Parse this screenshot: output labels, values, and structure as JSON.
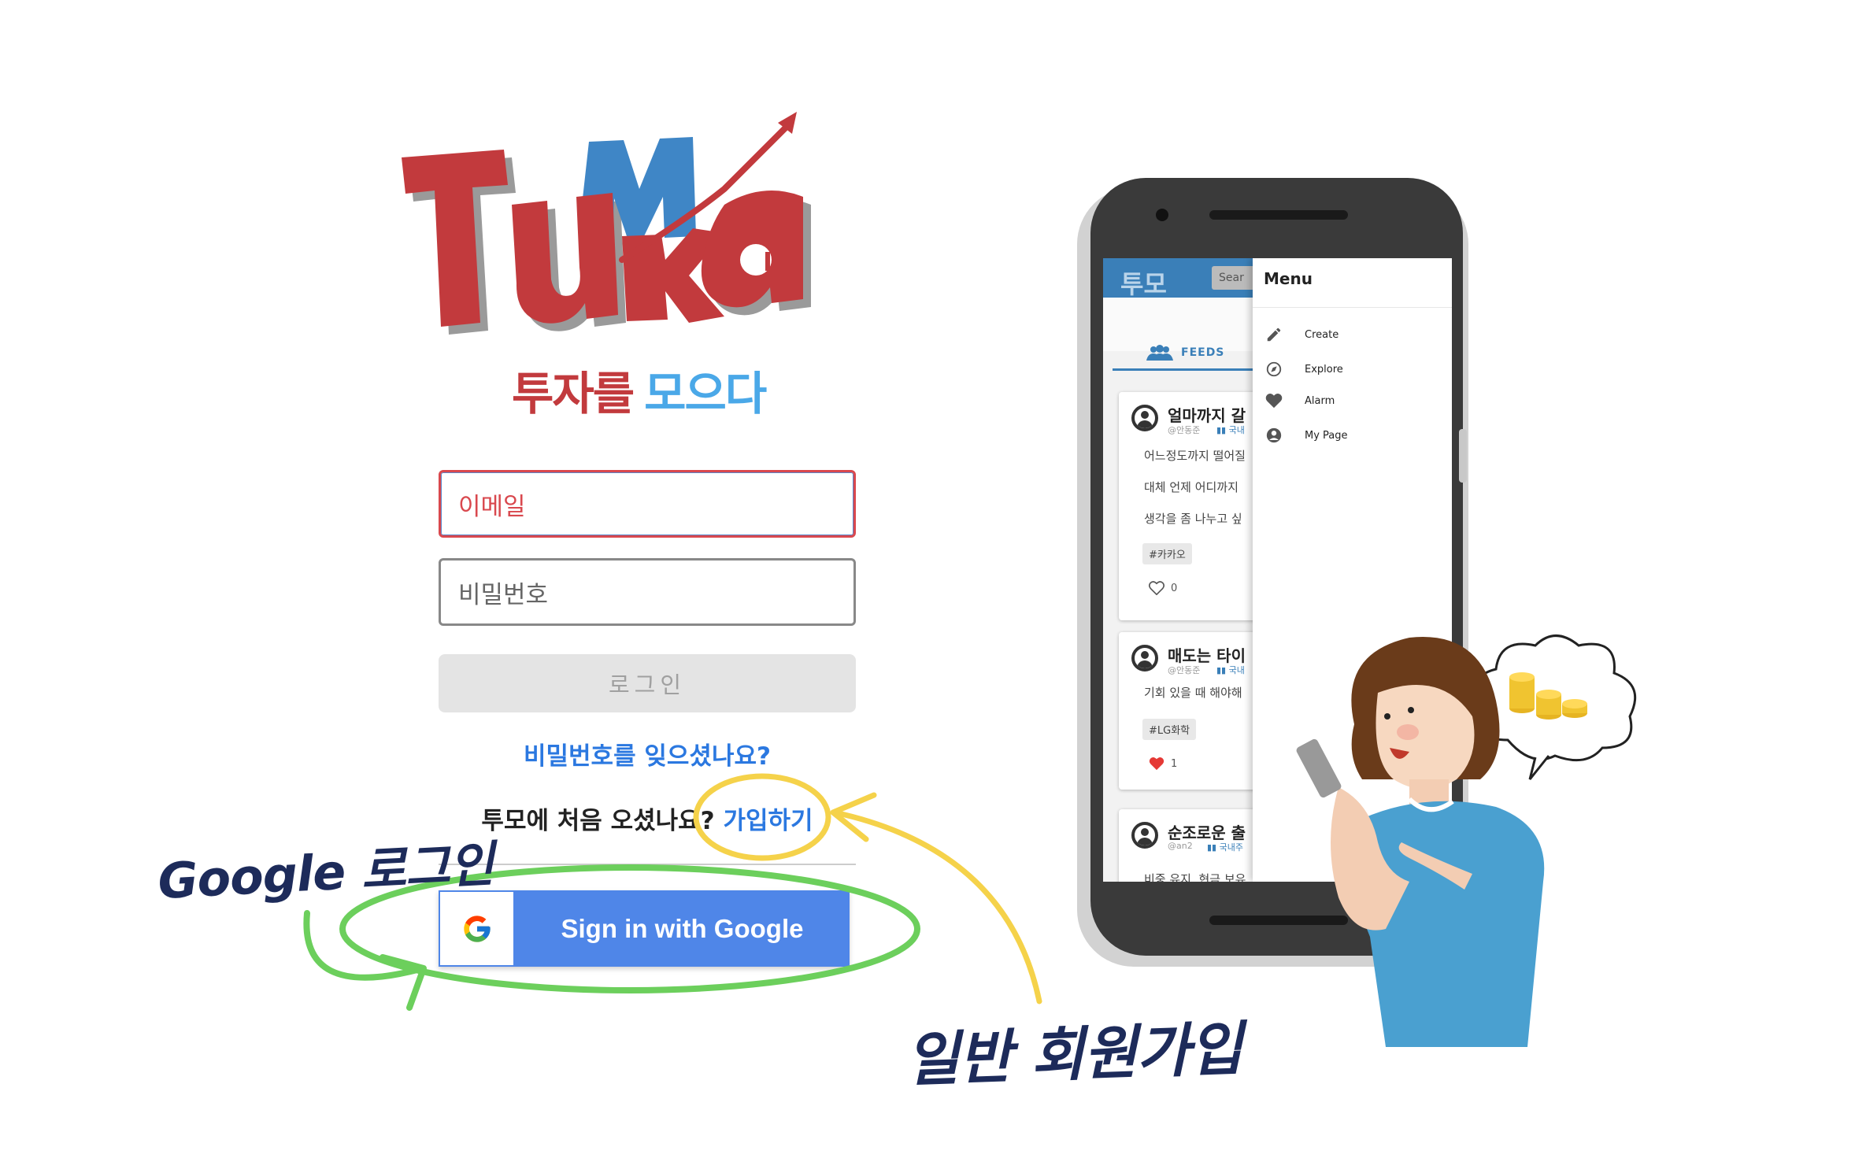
{
  "brand": {
    "logo_text": "TuMo",
    "tagline_part1": "투자를",
    "tagline_part2": "모으다"
  },
  "login": {
    "email_placeholder": "이메일",
    "password_placeholder": "비밀번호",
    "login_label": "로그인",
    "forgot_label": "비밀번호를 잊으셨나요?",
    "signup_prompt": "투모에 처음 오셨나요?",
    "signup_link": "가입하기",
    "google_label": "Sign in with Google"
  },
  "annotations": {
    "google_login": "Google 로그인",
    "signup": "일반 회원가입"
  },
  "phone": {
    "app_title": "투모",
    "search_placeholder": "Sear",
    "tab_feeds": "FEEDS",
    "feed": [
      {
        "title": "얼마까지 갈",
        "user": "@안동준",
        "category": "국내",
        "lines": [
          "어느정도까지 떨어질",
          "대체 언제 어디까지",
          "생각을 좀 나누고 싶"
        ],
        "tag": "#카카오",
        "likes": "0",
        "liked": false
      },
      {
        "title": "매도는 타이",
        "user": "@안동준",
        "category": "국내",
        "lines": [
          "기회 있을 때 해야해"
        ],
        "tag": "#LG화학",
        "likes": "1",
        "liked": true
      },
      {
        "title": "순조로운 출",
        "user": "@an2",
        "category": "국내주",
        "lines": [
          "비중 유지, 현금 보유"
        ],
        "tag": "",
        "likes": "",
        "liked": false
      }
    ],
    "drawer": {
      "title": "Menu",
      "items": [
        {
          "label": "Create",
          "icon": "pencil-icon"
        },
        {
          "label": "Explore",
          "icon": "compass-icon"
        },
        {
          "label": "Alarm",
          "icon": "heart-icon"
        },
        {
          "label": "My Page",
          "icon": "account-icon"
        }
      ]
    }
  },
  "colors": {
    "logo_red": "#c23a3d",
    "logo_blue": "#3f86c6",
    "link_blue": "#2b78e0",
    "google_blue": "#4f86e8",
    "highlight_yellow": "#f5d24a",
    "highlight_green": "#6ccf5c",
    "app_bar": "#3a7fb8"
  }
}
